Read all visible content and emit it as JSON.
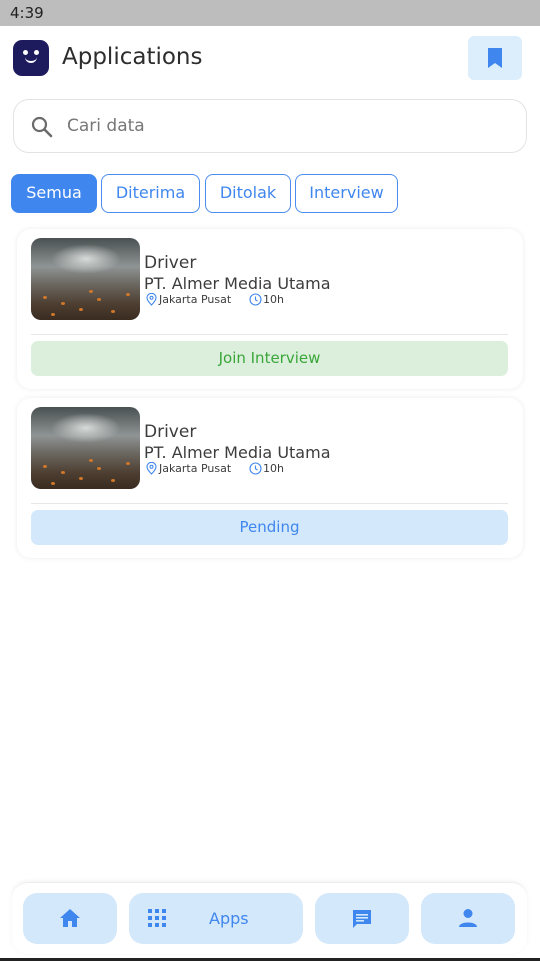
{
  "status_bar": {
    "time": "4:39"
  },
  "header": {
    "title": "Applications",
    "logo_icon": "smiley-face-logo",
    "bookmark_icon": "bookmark-icon"
  },
  "search": {
    "placeholder": "Cari data",
    "value": "",
    "icon": "search-icon"
  },
  "filters": [
    {
      "label": "Semua",
      "active": true
    },
    {
      "label": "Diterima",
      "active": false
    },
    {
      "label": "Ditolak",
      "active": false
    },
    {
      "label": "Interview",
      "active": false
    }
  ],
  "applications": [
    {
      "title": "Driver",
      "company": "PT. Almer Media Utama",
      "location": "Jakarta Pusat",
      "time": "10h",
      "status": "Join Interview",
      "status_color": "#3aa63a"
    },
    {
      "title": "Driver",
      "company": "PT. Almer Media Utama",
      "location": "Jakarta Pusat",
      "time": "10h",
      "status": "Pending",
      "status_color": "#3f86ee"
    }
  ],
  "bottom_nav": {
    "items": [
      {
        "icon": "home-icon"
      },
      {
        "icon": "apps-grid-icon",
        "label": "Apps"
      },
      {
        "icon": "chat-icon"
      },
      {
        "icon": "profile-icon"
      }
    ]
  },
  "colors": {
    "accent": "#3f86ee",
    "accent_light": "#d4e8fb",
    "success": "#3aa63a",
    "success_light": "#dcefdc",
    "logo": "#1e1a5e"
  }
}
